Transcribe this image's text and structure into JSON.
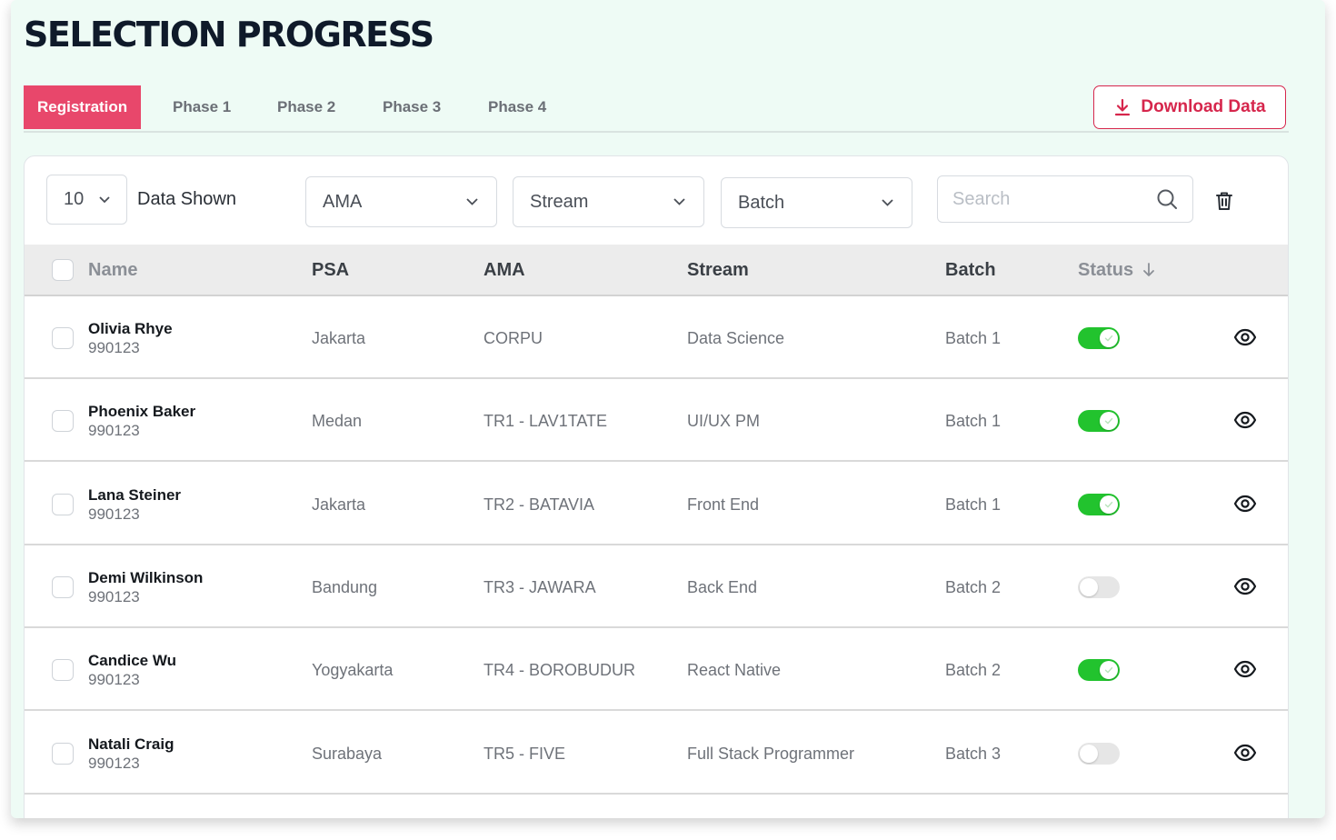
{
  "page": {
    "title": "SELECTION PROGRESS"
  },
  "tabs": [
    "Registration",
    "Phase 1",
    "Phase 2",
    "Phase 3",
    "Phase 4"
  ],
  "active_tab": "Registration",
  "download": {
    "label": "Download Data",
    "icon": "download-icon"
  },
  "controls": {
    "page_size": "10",
    "data_shown_label": "Data Shown",
    "ama_filter": "AMA",
    "stream_filter": "Stream",
    "batch_filter": "Batch",
    "search_placeholder": "Search"
  },
  "table": {
    "headers": {
      "name": "Name",
      "psa": "PSA",
      "ama": "AMA",
      "stream": "Stream",
      "batch": "Batch",
      "status": "Status"
    },
    "rows": [
      {
        "name": "Olivia Rhye",
        "id": "990123",
        "psa": "Jakarta",
        "ama": "CORPU",
        "stream": "Data Science",
        "batch": "Batch 1",
        "status": true
      },
      {
        "name": "Phoenix Baker",
        "id": "990123",
        "psa": "Medan",
        "ama": "TR1 - LAV1TATE",
        "stream": "UI/UX PM",
        "batch": "Batch 1",
        "status": true
      },
      {
        "name": "Lana Steiner",
        "id": "990123",
        "psa": "Jakarta",
        "ama": "TR2 - BATAVIA",
        "stream": "Front End",
        "batch": "Batch 1",
        "status": true
      },
      {
        "name": "Demi Wilkinson",
        "id": "990123",
        "psa": "Bandung",
        "ama": "TR3 - JAWARA",
        "stream": "Back End",
        "batch": "Batch 2",
        "status": false
      },
      {
        "name": "Candice Wu",
        "id": "990123",
        "psa": "Yogyakarta",
        "ama": "TR4 - BOROBUDUR",
        "stream": "React Native",
        "batch": "Batch 2",
        "status": true
      },
      {
        "name": "Natali Craig",
        "id": "990123",
        "psa": "Surabaya",
        "ama": "TR5 - FIVE",
        "stream": "Full Stack Programmer",
        "batch": "Batch 3",
        "status": false
      }
    ]
  },
  "colors": {
    "accent": "#e8476b",
    "accent_dark": "#d6264c",
    "toggle_on": "#22c32e",
    "background": "#eefbf5"
  }
}
